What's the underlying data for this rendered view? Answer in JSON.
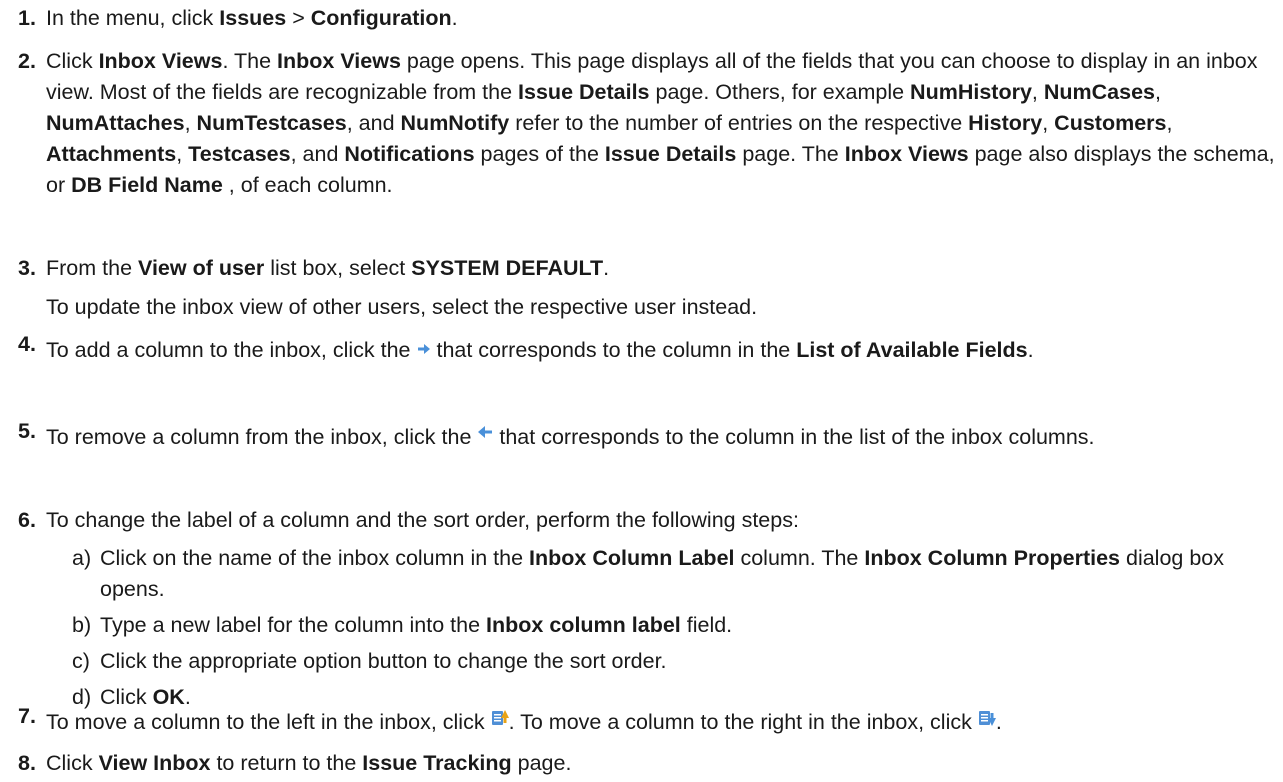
{
  "steps": [
    {
      "num": "1.",
      "parts": [
        "In the menu, click ",
        "Issues",
        " > ",
        "Configuration",
        "."
      ]
    },
    {
      "num": "2.",
      "parts": [
        "Click ",
        "Inbox Views",
        ". The ",
        "Inbox Views",
        " page opens. This page displays all of the fields that you can choose to display in an inbox view. Most of the fields are recognizable from the ",
        "Issue Details",
        " page. Others, for example ",
        "NumHistory",
        ", ",
        "NumCases",
        ", ",
        "NumAttaches",
        ", ",
        "NumTestcases",
        ", and ",
        "NumNotify",
        " refer to the number of entries on the respective ",
        "History",
        ", ",
        "Customers",
        ", ",
        "Attachments",
        ", ",
        "Testcases",
        ", and ",
        "Notifications",
        " pages of the ",
        "Issue Details",
        " page. The ",
        "Inbox Views",
        " page also displays the schema, or ",
        "DB Field Name",
        " , of each column."
      ]
    },
    {
      "num": "3.",
      "parts": [
        "From the ",
        "View of user",
        " list box, select ",
        "SYSTEM DEFAULT",
        "."
      ],
      "note": "To update the inbox view of other users, select the respective user instead."
    },
    {
      "num": "4.",
      "parts_a": [
        "To add a column to the inbox, click the "
      ],
      "icon": "arrow-right-icon",
      "parts_b": [
        " that corresponds to the column in the ",
        "List of Available Fields",
        "."
      ]
    },
    {
      "num": "5.",
      "parts_a": [
        "To remove a column from the inbox, click the "
      ],
      "icon": "arrow-left-icon",
      "parts_b": [
        " that corresponds to the column in the list of the inbox columns."
      ]
    },
    {
      "num": "6.",
      "parts": [
        "To change the label of a column and the sort order, perform the following steps:"
      ],
      "substeps": [
        {
          "letter": "a)",
          "parts": [
            "Click on the name of the inbox column in the ",
            "Inbox Column Label",
            " column. The ",
            "Inbox Column Properties",
            " dialog box opens."
          ]
        },
        {
          "letter": "b)",
          "parts": [
            "Type a new label for the column into the ",
            "Inbox column label",
            " field."
          ]
        },
        {
          "letter": "c)",
          "parts": [
            "Click the appropriate option button to change the sort order."
          ]
        },
        {
          "letter": "d)",
          "parts": [
            "Click ",
            "OK",
            "."
          ]
        }
      ]
    },
    {
      "num": "7.",
      "parts_a": [
        "To move a column to the left in the inbox, click "
      ],
      "icon_a": "move-left-icon",
      "parts_b": [
        ". To move a column to the right in the inbox, click "
      ],
      "icon_b": "move-right-icon",
      "parts_c": [
        "."
      ]
    },
    {
      "num": "8.",
      "parts": [
        "Click ",
        "View Inbox",
        " to return to the ",
        "Issue Tracking",
        " page."
      ]
    }
  ],
  "colors": {
    "text": "#1a1a1a",
    "arrow": "#4a90d9",
    "doc_icon": "#4f8fd6",
    "doc_arrow": "#e8a317"
  }
}
